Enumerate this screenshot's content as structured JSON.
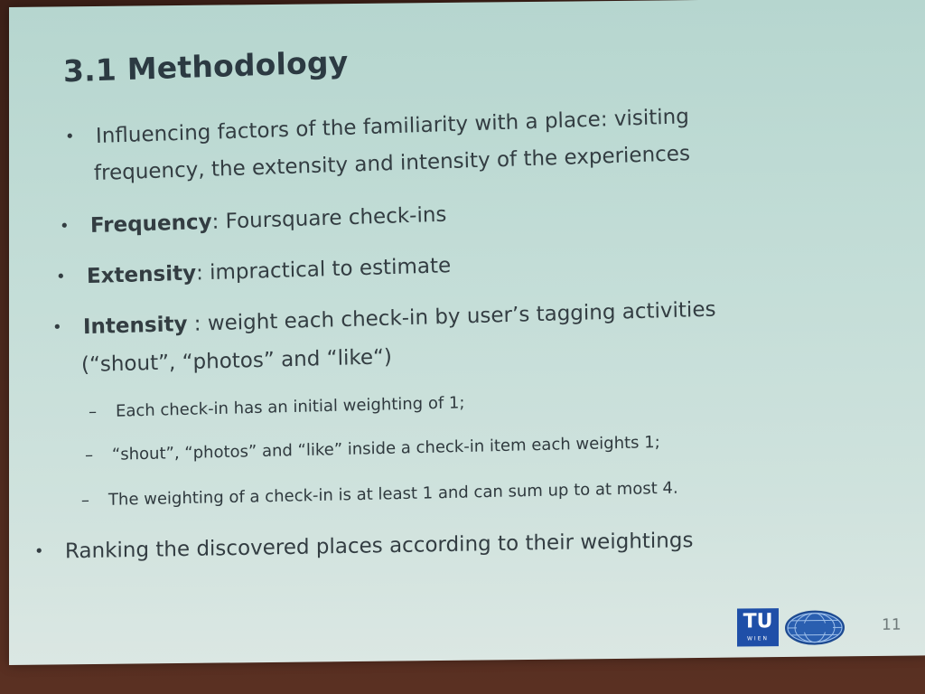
{
  "slide": {
    "title": "3.1 Methodology",
    "bullets": [
      {
        "line1": "Influencing factors of the familiarity with a place: visiting",
        "line2": "frequency, the extensity and intensity of the experiences"
      },
      {
        "term": "Frequency",
        "text": ": Foursquare check-ins"
      },
      {
        "term": "Extensity",
        "text": ": impractical to estimate"
      },
      {
        "term": "Intensity",
        "text": " : weight each check-in by user’s tagging activities",
        "line2": "(“shout”, “photos” and “like“)",
        "subitems": [
          "Each check-in has an initial weighting of 1;",
          "“shout”, “photos” and “like” inside a check-in item each weights 1;",
          "The weighting of a check-in is at least 1 and can sum up to at most 4."
        ]
      },
      {
        "line1": "Ranking the discovered places according to their weightings"
      }
    ],
    "bullet_glyph": "•",
    "dash_glyph": "–",
    "page_number": "11"
  },
  "logos": {
    "tu_text": "TU",
    "tu_sub": "WIEN",
    "tu_color": "#1f4fa8",
    "globe_icon": "globe-logo-icon"
  }
}
